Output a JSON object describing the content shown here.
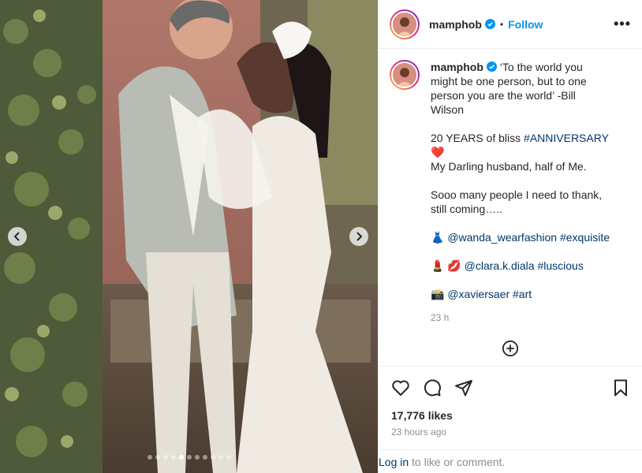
{
  "colors": {
    "accent": "#0095f6",
    "link": "#00376b",
    "muted": "#8e8e8e",
    "verified": "#0095f6"
  },
  "header": {
    "username": "mamphob",
    "separator": "•",
    "follow_label": "Follow",
    "more_label": "•••"
  },
  "caption": {
    "username": "mamphob",
    "lines": [
      "‘To the world you",
      "might be one person, but to one",
      "person you are the world’ -Bill",
      "Wilson"
    ],
    "anniv_prefix": "20 YEARS of bliss ",
    "anniv_tag": "#ANNIVERSARY",
    "heart": "❤️",
    "darling": "My Darling husband, half of Me.",
    "thanks_1": "Sooo many people I need to thank,",
    "thanks_2": "still coming…..",
    "credit1_emoji": "👗",
    "credit1_user": "@wanda_wearfashion",
    "credit1_tag": "#exquisite",
    "credit2_emoji": "💄 💋",
    "credit2_user": "@clara.k.diala",
    "credit2_tag": "#luscious",
    "credit3_emoji": "📸",
    "credit3_user": "@xaviersaer",
    "credit3_tag": "#art",
    "time": "23 h"
  },
  "icons": {
    "add_comment": "plus-circle-icon",
    "like": "heart-icon",
    "comment": "comment-icon",
    "share": "paper-plane-icon",
    "save": "bookmark-icon",
    "prev": "chevron-left-icon",
    "next": "chevron-right-icon"
  },
  "engagement": {
    "likes": "17,776 likes",
    "posted": "23 hours ago"
  },
  "login": {
    "link": "Log in",
    "rest": " to like or comment."
  },
  "carousel": {
    "slide_count": 11,
    "active_index": 4
  }
}
